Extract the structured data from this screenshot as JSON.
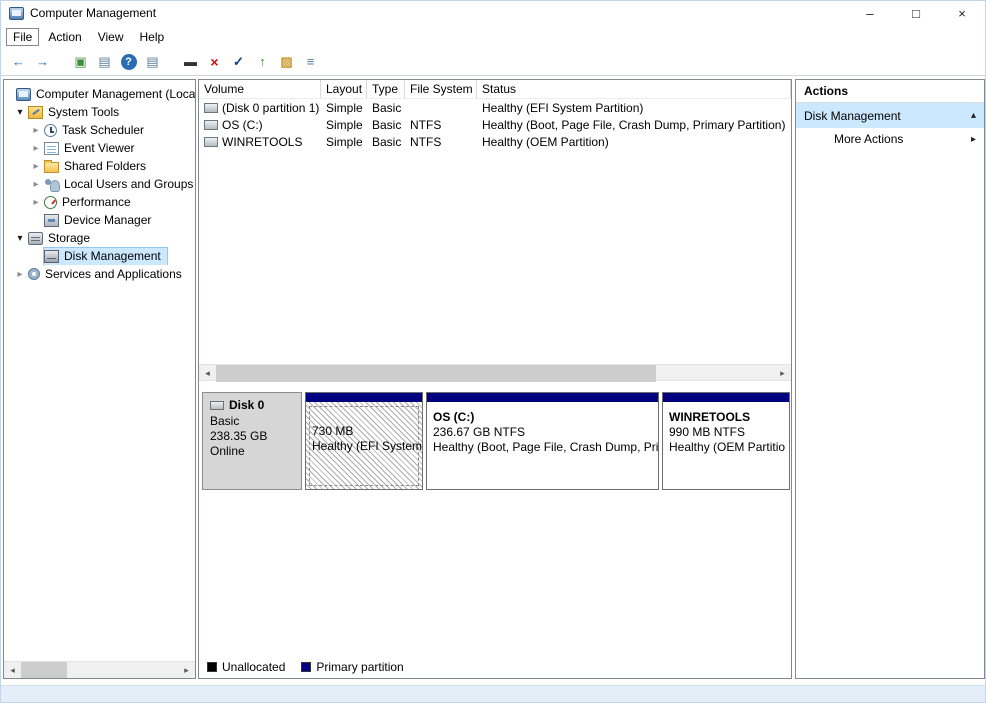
{
  "window": {
    "title": "Computer Management",
    "controls": {
      "minimize": "–",
      "maximize": "□",
      "close": "×"
    }
  },
  "menubar": {
    "items": [
      "File",
      "Action",
      "View",
      "Help"
    ]
  },
  "toolbar": {
    "buttons": [
      {
        "name": "back",
        "glyph": "←"
      },
      {
        "name": "forward",
        "glyph": "→"
      },
      {
        "name": "show-console-tree",
        "glyph": "▣"
      },
      {
        "name": "export-list",
        "glyph": "▤"
      },
      {
        "name": "help",
        "glyph": "?"
      },
      {
        "name": "views",
        "glyph": "▤"
      },
      {
        "name": "console-window",
        "glyph": "▬"
      },
      {
        "name": "delete",
        "glyph": "×"
      },
      {
        "name": "properties",
        "glyph": "✓"
      },
      {
        "name": "up",
        "glyph": "↑"
      },
      {
        "name": "open-folder",
        "glyph": "▨"
      },
      {
        "name": "fields",
        "glyph": "≡"
      }
    ]
  },
  "glyphs": {
    "expanded": "▾",
    "collapsed": "▸",
    "scroll_left": "◂",
    "scroll_right": "▸",
    "action_collapse": "▴",
    "action_expand": "▸"
  },
  "tree": {
    "items": [
      {
        "label": "Computer Management (Local)"
      },
      {
        "label": "System Tools"
      },
      {
        "label": "Task Scheduler"
      },
      {
        "label": "Event Viewer"
      },
      {
        "label": "Shared Folders"
      },
      {
        "label": "Local Users and Groups"
      },
      {
        "label": "Performance"
      },
      {
        "label": "Device Manager"
      },
      {
        "label": "Storage"
      },
      {
        "label": "Disk Management"
      },
      {
        "label": "Services and Applications"
      }
    ]
  },
  "volume_list": {
    "columns": [
      "Volume",
      "Layout",
      "Type",
      "File System",
      "Status"
    ],
    "rows": [
      {
        "volume": "(Disk 0 partition 1)",
        "layout": "Simple",
        "type": "Basic",
        "file_system": "",
        "status": "Healthy (EFI System Partition)"
      },
      {
        "volume": "OS (C:)",
        "layout": "Simple",
        "type": "Basic",
        "file_system": "NTFS",
        "status": "Healthy (Boot, Page File, Crash Dump, Primary Partition)"
      },
      {
        "volume": "WINRETOOLS",
        "layout": "Simple",
        "type": "Basic",
        "file_system": "NTFS",
        "status": "Healthy (OEM Partition)"
      }
    ]
  },
  "disk_view": {
    "disk": {
      "name": "Disk 0",
      "type": "Basic",
      "size": "238.35 GB",
      "status": "Online"
    },
    "partitions": [
      {
        "name": "",
        "size_line": "730 MB",
        "status_line": "Healthy (EFI System"
      },
      {
        "name": "OS  (C:)",
        "size_line": "236.67 GB NTFS",
        "status_line": "Healthy (Boot, Page File, Crash Dump, Pri"
      },
      {
        "name": "WINRETOOLS",
        "size_line": "990 MB NTFS",
        "status_line": "Healthy (OEM Partitio"
      }
    ],
    "legend": [
      {
        "label": "Unallocated",
        "color": "#000000"
      },
      {
        "label": "Primary partition",
        "color": "#00007f"
      }
    ]
  },
  "actions": {
    "title": "Actions",
    "items": [
      {
        "label": "Disk Management"
      },
      {
        "label": "More Actions"
      }
    ]
  },
  "colors": {
    "selection": "#cce8ff",
    "primary_partition": "#000080",
    "unallocated": "#000000"
  },
  "styles": {
    "primary_bar": "background:#000080",
    "unallocated_swatch": "background:#000000",
    "primary_swatch": "background:#00007f"
  }
}
